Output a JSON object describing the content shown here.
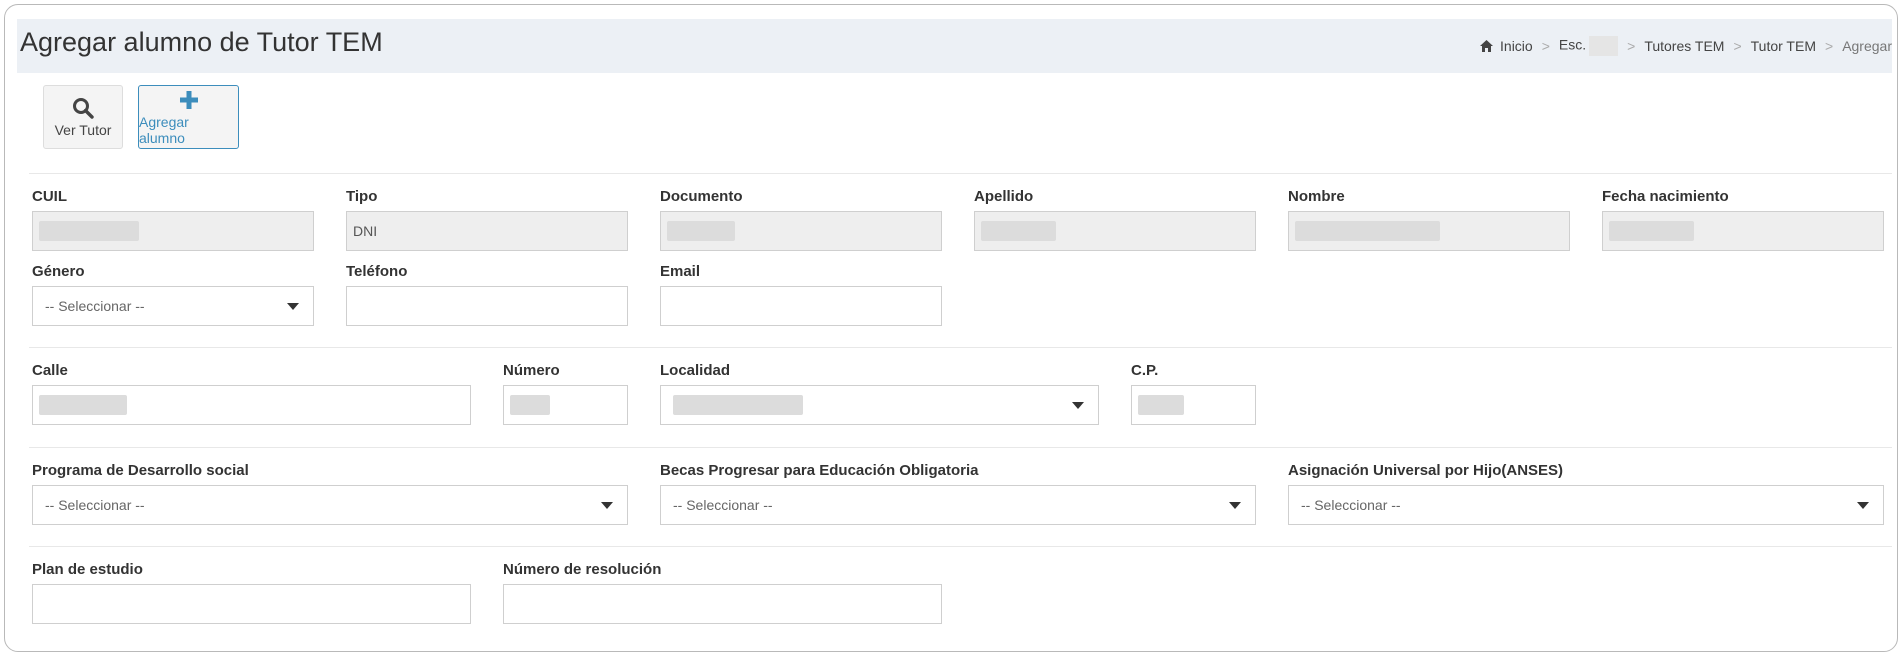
{
  "header": {
    "title": "Agregar alumno de Tutor TEM",
    "breadcrumb": [
      {
        "label": "Inicio",
        "icon": "home-icon"
      },
      {
        "label": "Esc."
      },
      {
        "label": "Tutores TEM"
      },
      {
        "label": "Tutor TEM"
      },
      {
        "label": "Agregar"
      }
    ],
    "separator": ">"
  },
  "toolbar": {
    "ver_tutor_label": "Ver Tutor",
    "agregar_alumno_label": "Agregar alumno",
    "accent_color": "#3c8dbc"
  },
  "form": {
    "cuil": {
      "label": "CUIL",
      "value": ""
    },
    "tipo": {
      "label": "Tipo",
      "value": "DNI"
    },
    "documento": {
      "label": "Documento",
      "value": ""
    },
    "apellido": {
      "label": "Apellido",
      "value": ""
    },
    "nombre": {
      "label": "Nombre",
      "value": ""
    },
    "fecha_nacimiento": {
      "label": "Fecha nacimiento",
      "value": ""
    },
    "genero": {
      "label": "Género",
      "selected": "-- Seleccionar --"
    },
    "telefono": {
      "label": "Teléfono",
      "value": ""
    },
    "email": {
      "label": "Email",
      "value": ""
    },
    "calle": {
      "label": "Calle",
      "value": ""
    },
    "numero": {
      "label": "Número",
      "value": ""
    },
    "localidad": {
      "label": "Localidad",
      "selected": ""
    },
    "cp": {
      "label": "C.P.",
      "value": ""
    },
    "programa": {
      "label": "Programa de Desarrollo social",
      "selected": "-- Seleccionar --"
    },
    "becas": {
      "label": "Becas Progresar para Educación Obligatoria",
      "selected": "-- Seleccionar --"
    },
    "asignacion": {
      "label": "Asignación Universal por Hijo(ANSES)",
      "selected": "-- Seleccionar --"
    },
    "plan": {
      "label": "Plan de estudio",
      "value": ""
    },
    "resolucion": {
      "label": "Número de resolución",
      "value": ""
    }
  }
}
